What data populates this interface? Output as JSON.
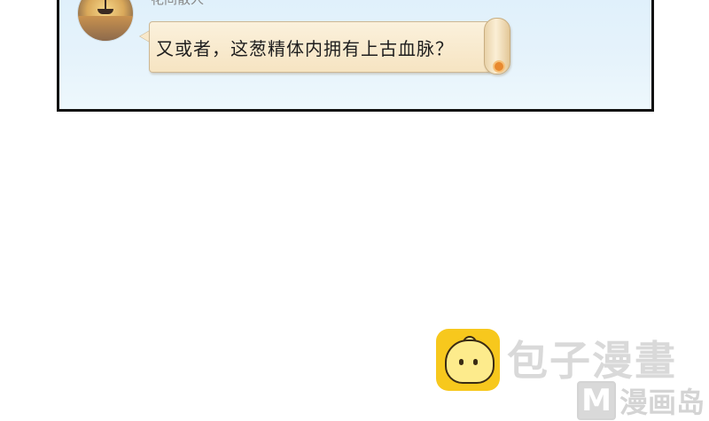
{
  "comic": {
    "username": "花间散人",
    "message": "又或者，这葱精体内拥有上古血脉？"
  },
  "watermarks": {
    "primary_text": "包子漫畫",
    "secondary_mark": "M",
    "secondary_text": "漫画岛"
  },
  "icons": {
    "logo": "steamed-bun-icon",
    "avatar": "sunset-boat-avatar"
  },
  "colors": {
    "panel_background": "#e3f2fb",
    "bubble": "#f8e8cb",
    "logo_yellow": "#f7c81d",
    "watermark_gray": "#d9d9d9"
  }
}
